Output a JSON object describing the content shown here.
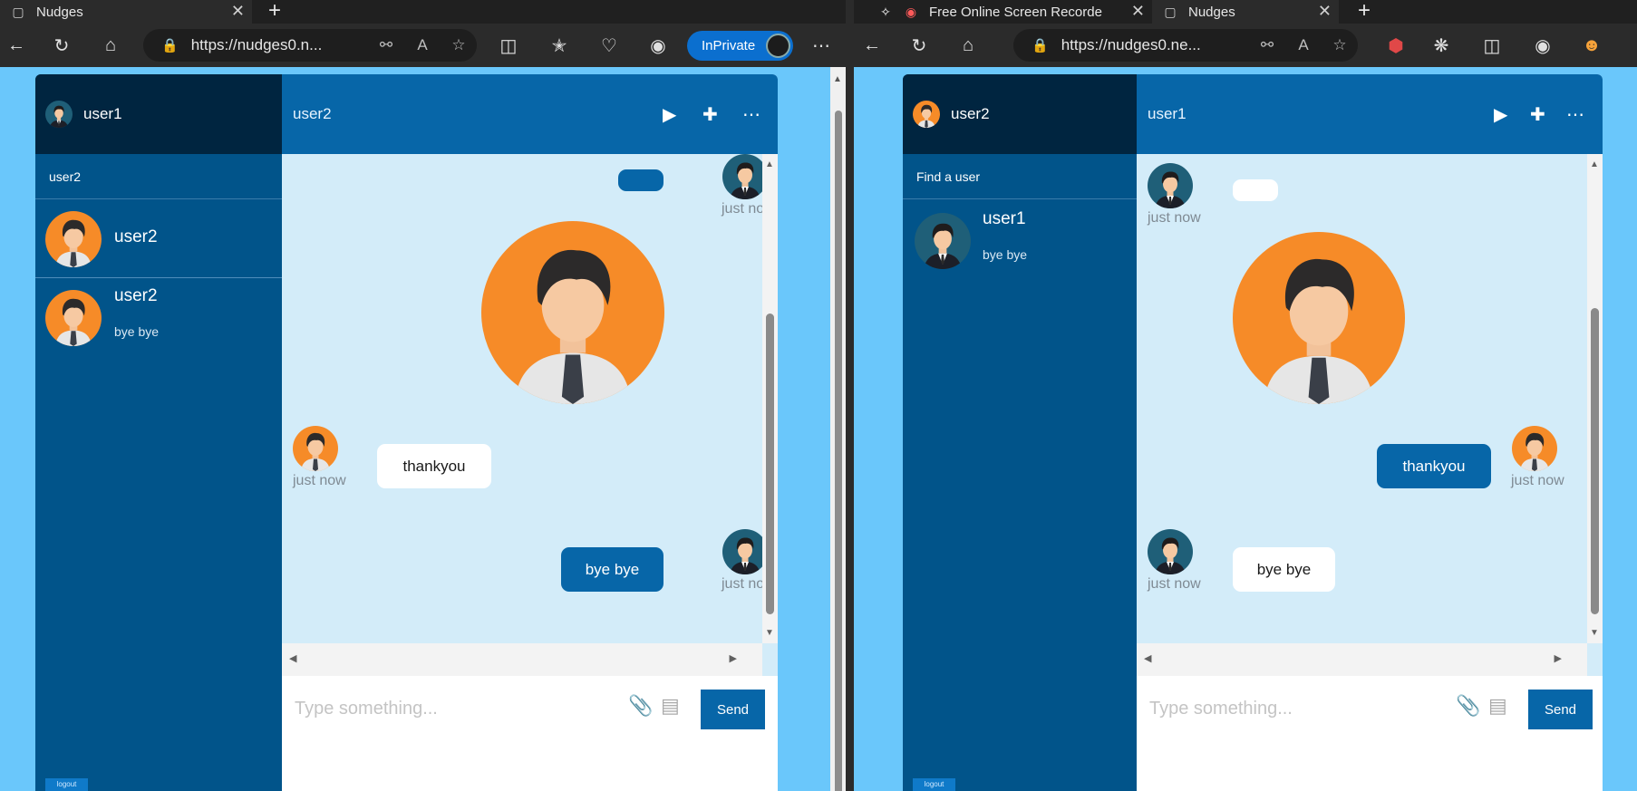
{
  "left_window": {
    "tabs": [
      {
        "title": "Nudges",
        "icon": "document-icon"
      }
    ],
    "url": "https://nudges0.n...",
    "inprivate_label": "InPrivate"
  },
  "right_window": {
    "tabs": [
      {
        "title": "Free Online Screen Recorde",
        "icon": "recorder-icon"
      },
      {
        "title": "Nudges",
        "icon": "document-icon"
      }
    ],
    "url": "https://nudges0.ne..."
  },
  "chat_left": {
    "me": "user1",
    "active_contact": "user2",
    "sidebar_subtitle": "user2",
    "conversations": [
      {
        "name": "user2",
        "preview": ""
      },
      {
        "name": "user2",
        "preview": "bye bye"
      }
    ],
    "messages": {
      "thankyou": {
        "text": "thankyou",
        "time": "just now"
      },
      "byebye": {
        "text": "bye bye",
        "time": "just now"
      },
      "nudge": {
        "time": "just now"
      }
    },
    "composer": {
      "placeholder": "Type something...",
      "send_label": "Send"
    },
    "logout_label": "logout"
  },
  "chat_right": {
    "me": "user2",
    "active_contact": "user1",
    "sidebar_subtitle": "Find a user",
    "conversations": [
      {
        "name": "user1",
        "preview": "bye bye"
      }
    ],
    "messages": {
      "nudge": {
        "time": "just now"
      },
      "thankyou": {
        "text": "thankyou",
        "time": "just now"
      },
      "byebye": {
        "text": "bye bye",
        "time": "just now"
      }
    },
    "composer": {
      "placeholder": "Type something...",
      "send_label": "Send"
    },
    "logout_label": "logout"
  },
  "colors": {
    "page_bg": "#6ac7fb",
    "sidebar": "#01548a",
    "sidebar_header": "#002540",
    "chat_header": "#0766a8",
    "chat_bg": "#d3ecf9",
    "avatar_orange": "#f68b28",
    "avatar_teal": "#1f5f78"
  }
}
